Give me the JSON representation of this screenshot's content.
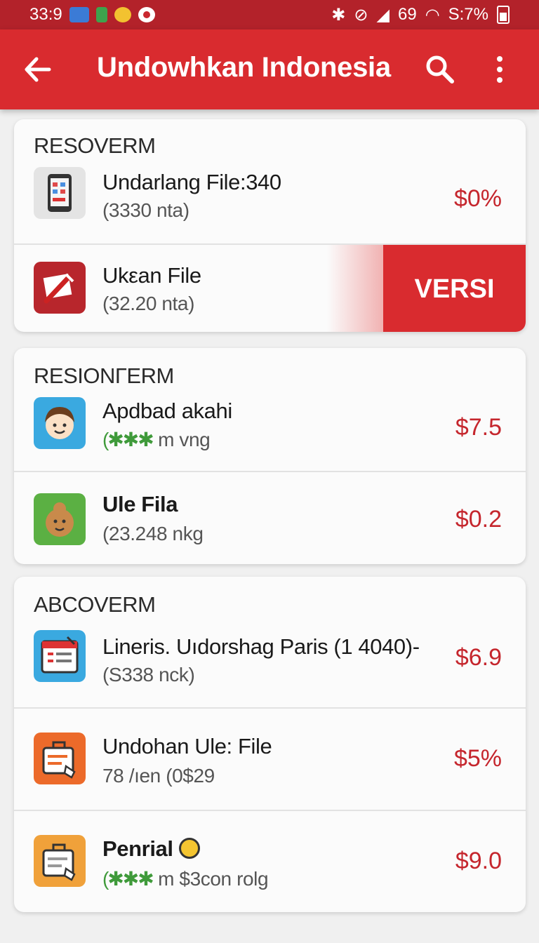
{
  "status_bar": {
    "time": "33:9",
    "signal_text": "69",
    "battery_text": "S:7%"
  },
  "app_bar": {
    "title": "Undowhkan Indonesia"
  },
  "sections": [
    {
      "title": "RESOVERM",
      "items": [
        {
          "name": "Undarlang File:340",
          "sub": "(3330 nta)",
          "price": "$0%",
          "icon": "phone-icon"
        },
        {
          "name": "Ukεan File",
          "sub": "(32.20 nta)",
          "price": "",
          "icon": "pen-icon",
          "swipe_action": "VERSI"
        }
      ]
    },
    {
      "title": "RESIONΓERM",
      "items": [
        {
          "name": "Apdbad akahi",
          "stars": "(✱✱✱",
          "sub_tail": " m vng",
          "price": "$7.5",
          "icon": "face-icon"
        },
        {
          "name": "Ule Fila",
          "sub": "(23.248 nkg",
          "price": "$0.2",
          "icon": "cookie-icon"
        }
      ]
    },
    {
      "title": "ABCOVERM",
      "items": [
        {
          "name": "Lineris. Uıdorshag Paris (1 4040)-",
          "sub": "(S338 nck)",
          "price": "$6.9",
          "icon": "calendar-icon"
        },
        {
          "name": "Undohan Ule: File",
          "sub": "78 /ıen (0$29",
          "price": "$5%",
          "icon": "briefcase-icon"
        },
        {
          "name": "Penrial",
          "stars": "(✱✱✱",
          "sub_tail": " m $3con rolg",
          "price": "$9.0",
          "icon": "bag-icon"
        }
      ]
    }
  ],
  "colors": {
    "brand": "#d92b2f",
    "price": "#c5262d",
    "stars": "#3f9a3a"
  }
}
